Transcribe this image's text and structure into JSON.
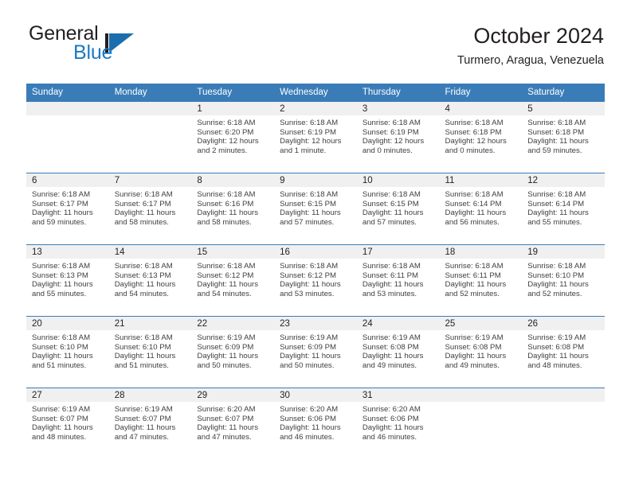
{
  "brand": {
    "word_one": "General",
    "word_two": "Blue",
    "mark": "blue-triangle-logo"
  },
  "header": {
    "title": "October 2024",
    "subtitle": "Turmero, Aragua, Venezuela"
  },
  "colors": {
    "header_blue": "#3a7cb8",
    "brand_blue": "#1b7ac2",
    "daynum_band": "#f0f0f0",
    "text": "#231f20",
    "body_text": "#404040"
  },
  "weekday_headers": [
    "Sunday",
    "Monday",
    "Tuesday",
    "Wednesday",
    "Thursday",
    "Friday",
    "Saturday"
  ],
  "labels": {
    "sunrise_prefix": "Sunrise:",
    "sunset_prefix": "Sunset:",
    "daylight_prefix": "Daylight:"
  },
  "weeks": [
    [
      {
        "day": "",
        "empty": true
      },
      {
        "day": "",
        "empty": true
      },
      {
        "day": "1",
        "sunrise": "Sunrise: 6:18 AM",
        "sunset": "Sunset: 6:20 PM",
        "daylight_l1": "Daylight: 12 hours",
        "daylight_l2": "and 2 minutes."
      },
      {
        "day": "2",
        "sunrise": "Sunrise: 6:18 AM",
        "sunset": "Sunset: 6:19 PM",
        "daylight_l1": "Daylight: 12 hours",
        "daylight_l2": "and 1 minute."
      },
      {
        "day": "3",
        "sunrise": "Sunrise: 6:18 AM",
        "sunset": "Sunset: 6:19 PM",
        "daylight_l1": "Daylight: 12 hours",
        "daylight_l2": "and 0 minutes."
      },
      {
        "day": "4",
        "sunrise": "Sunrise: 6:18 AM",
        "sunset": "Sunset: 6:18 PM",
        "daylight_l1": "Daylight: 12 hours",
        "daylight_l2": "and 0 minutes."
      },
      {
        "day": "5",
        "sunrise": "Sunrise: 6:18 AM",
        "sunset": "Sunset: 6:18 PM",
        "daylight_l1": "Daylight: 11 hours",
        "daylight_l2": "and 59 minutes."
      }
    ],
    [
      {
        "day": "6",
        "sunrise": "Sunrise: 6:18 AM",
        "sunset": "Sunset: 6:17 PM",
        "daylight_l1": "Daylight: 11 hours",
        "daylight_l2": "and 59 minutes."
      },
      {
        "day": "7",
        "sunrise": "Sunrise: 6:18 AM",
        "sunset": "Sunset: 6:17 PM",
        "daylight_l1": "Daylight: 11 hours",
        "daylight_l2": "and 58 minutes."
      },
      {
        "day": "8",
        "sunrise": "Sunrise: 6:18 AM",
        "sunset": "Sunset: 6:16 PM",
        "daylight_l1": "Daylight: 11 hours",
        "daylight_l2": "and 58 minutes."
      },
      {
        "day": "9",
        "sunrise": "Sunrise: 6:18 AM",
        "sunset": "Sunset: 6:15 PM",
        "daylight_l1": "Daylight: 11 hours",
        "daylight_l2": "and 57 minutes."
      },
      {
        "day": "10",
        "sunrise": "Sunrise: 6:18 AM",
        "sunset": "Sunset: 6:15 PM",
        "daylight_l1": "Daylight: 11 hours",
        "daylight_l2": "and 57 minutes."
      },
      {
        "day": "11",
        "sunrise": "Sunrise: 6:18 AM",
        "sunset": "Sunset: 6:14 PM",
        "daylight_l1": "Daylight: 11 hours",
        "daylight_l2": "and 56 minutes."
      },
      {
        "day": "12",
        "sunrise": "Sunrise: 6:18 AM",
        "sunset": "Sunset: 6:14 PM",
        "daylight_l1": "Daylight: 11 hours",
        "daylight_l2": "and 55 minutes."
      }
    ],
    [
      {
        "day": "13",
        "sunrise": "Sunrise: 6:18 AM",
        "sunset": "Sunset: 6:13 PM",
        "daylight_l1": "Daylight: 11 hours",
        "daylight_l2": "and 55 minutes."
      },
      {
        "day": "14",
        "sunrise": "Sunrise: 6:18 AM",
        "sunset": "Sunset: 6:13 PM",
        "daylight_l1": "Daylight: 11 hours",
        "daylight_l2": "and 54 minutes."
      },
      {
        "day": "15",
        "sunrise": "Sunrise: 6:18 AM",
        "sunset": "Sunset: 6:12 PM",
        "daylight_l1": "Daylight: 11 hours",
        "daylight_l2": "and 54 minutes."
      },
      {
        "day": "16",
        "sunrise": "Sunrise: 6:18 AM",
        "sunset": "Sunset: 6:12 PM",
        "daylight_l1": "Daylight: 11 hours",
        "daylight_l2": "and 53 minutes."
      },
      {
        "day": "17",
        "sunrise": "Sunrise: 6:18 AM",
        "sunset": "Sunset: 6:11 PM",
        "daylight_l1": "Daylight: 11 hours",
        "daylight_l2": "and 53 minutes."
      },
      {
        "day": "18",
        "sunrise": "Sunrise: 6:18 AM",
        "sunset": "Sunset: 6:11 PM",
        "daylight_l1": "Daylight: 11 hours",
        "daylight_l2": "and 52 minutes."
      },
      {
        "day": "19",
        "sunrise": "Sunrise: 6:18 AM",
        "sunset": "Sunset: 6:10 PM",
        "daylight_l1": "Daylight: 11 hours",
        "daylight_l2": "and 52 minutes."
      }
    ],
    [
      {
        "day": "20",
        "sunrise": "Sunrise: 6:18 AM",
        "sunset": "Sunset: 6:10 PM",
        "daylight_l1": "Daylight: 11 hours",
        "daylight_l2": "and 51 minutes."
      },
      {
        "day": "21",
        "sunrise": "Sunrise: 6:18 AM",
        "sunset": "Sunset: 6:10 PM",
        "daylight_l1": "Daylight: 11 hours",
        "daylight_l2": "and 51 minutes."
      },
      {
        "day": "22",
        "sunrise": "Sunrise: 6:19 AM",
        "sunset": "Sunset: 6:09 PM",
        "daylight_l1": "Daylight: 11 hours",
        "daylight_l2": "and 50 minutes."
      },
      {
        "day": "23",
        "sunrise": "Sunrise: 6:19 AM",
        "sunset": "Sunset: 6:09 PM",
        "daylight_l1": "Daylight: 11 hours",
        "daylight_l2": "and 50 minutes."
      },
      {
        "day": "24",
        "sunrise": "Sunrise: 6:19 AM",
        "sunset": "Sunset: 6:08 PM",
        "daylight_l1": "Daylight: 11 hours",
        "daylight_l2": "and 49 minutes."
      },
      {
        "day": "25",
        "sunrise": "Sunrise: 6:19 AM",
        "sunset": "Sunset: 6:08 PM",
        "daylight_l1": "Daylight: 11 hours",
        "daylight_l2": "and 49 minutes."
      },
      {
        "day": "26",
        "sunrise": "Sunrise: 6:19 AM",
        "sunset": "Sunset: 6:08 PM",
        "daylight_l1": "Daylight: 11 hours",
        "daylight_l2": "and 48 minutes."
      }
    ],
    [
      {
        "day": "27",
        "sunrise": "Sunrise: 6:19 AM",
        "sunset": "Sunset: 6:07 PM",
        "daylight_l1": "Daylight: 11 hours",
        "daylight_l2": "and 48 minutes."
      },
      {
        "day": "28",
        "sunrise": "Sunrise: 6:19 AM",
        "sunset": "Sunset: 6:07 PM",
        "daylight_l1": "Daylight: 11 hours",
        "daylight_l2": "and 47 minutes."
      },
      {
        "day": "29",
        "sunrise": "Sunrise: 6:20 AM",
        "sunset": "Sunset: 6:07 PM",
        "daylight_l1": "Daylight: 11 hours",
        "daylight_l2": "and 47 minutes."
      },
      {
        "day": "30",
        "sunrise": "Sunrise: 6:20 AM",
        "sunset": "Sunset: 6:06 PM",
        "daylight_l1": "Daylight: 11 hours",
        "daylight_l2": "and 46 minutes."
      },
      {
        "day": "31",
        "sunrise": "Sunrise: 6:20 AM",
        "sunset": "Sunset: 6:06 PM",
        "daylight_l1": "Daylight: 11 hours",
        "daylight_l2": "and 46 minutes."
      },
      {
        "day": "",
        "empty": true
      },
      {
        "day": "",
        "empty": true
      }
    ]
  ]
}
